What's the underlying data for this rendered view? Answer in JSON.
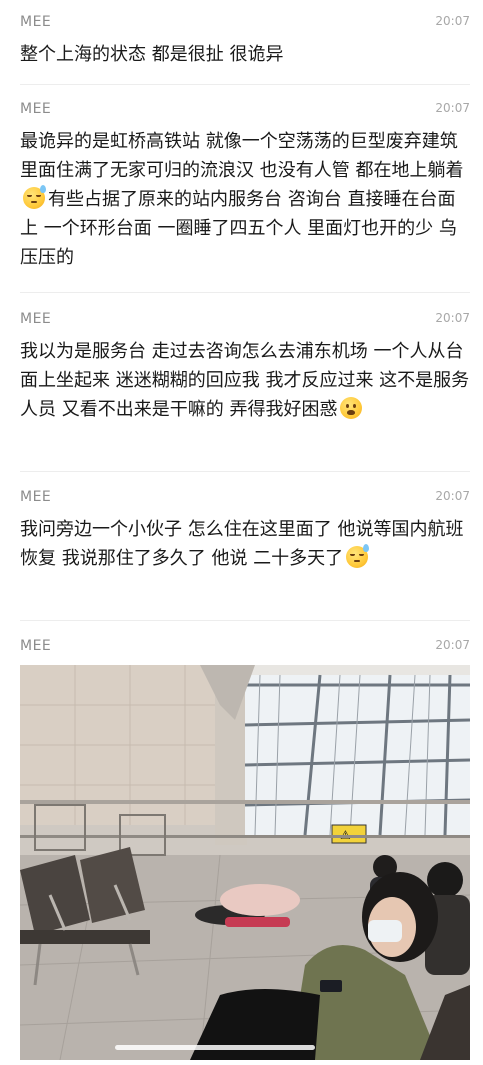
{
  "messages": [
    {
      "sender": "MEE",
      "time": "20:07",
      "text_parts": [
        "整个上海的状态 都是很扯 很诡异"
      ]
    },
    {
      "sender": "MEE",
      "time": "20:07",
      "text_parts": [
        "最诡异的是虹桥高铁站 就像一个空荡荡的巨型废弃建筑 里面住满了无家可归的流浪汉 也没有人管 都在地上躺着",
        "有些占据了原来的站内服务台 咨询台 直接睡在台面上 一个环形台面 一圈睡了四五个人 里面灯也开的少 乌压压的"
      ],
      "emoji": "sleepy-sweat-emoji"
    },
    {
      "sender": "MEE",
      "time": "20:07",
      "text_parts": [
        "我以为是服务台 走过去咨询怎么去浦东机场 一个人从台面上坐起来 迷迷糊糊的回应我 我才反应过来 这不是服务人员 又看不出来是干嘛的 弄得我好困惑"
      ],
      "emoji": "frowning-emoji"
    },
    {
      "sender": "MEE",
      "time": "20:07",
      "text_parts": [
        "我问旁边一个小伙子 怎么住在这里面了 他说等国内航班恢复 我说那住了多久了 他说 二十多天了"
      ],
      "emoji": "sleepy-sweat-emoji"
    },
    {
      "sender": "MEE",
      "time": "20:07",
      "image": "airport-terminal-photo"
    }
  ],
  "photo": {
    "sign_text": "⚠"
  },
  "colors": {
    "sender": "#8c8c8c",
    "time": "#a8a8a8",
    "text": "#1a1a1a",
    "divider": "#ededed"
  }
}
